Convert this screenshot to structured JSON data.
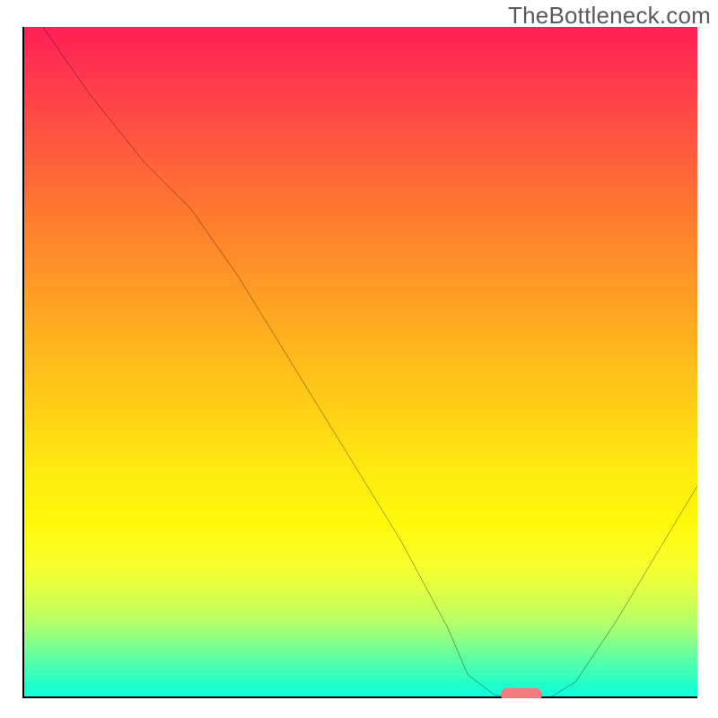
{
  "watermark": "TheBottleneck.com",
  "chart_data": {
    "type": "line",
    "title": "",
    "xlabel": "",
    "ylabel": "",
    "xlim": [
      0,
      100
    ],
    "ylim": [
      0,
      100
    ],
    "grid": false,
    "legend": false,
    "background_gradient": {
      "top": "#ff1f57",
      "bottom": "#0affe0",
      "direction": "vertical",
      "meaning": "bottleneck-severity-heatmap"
    },
    "series": [
      {
        "name": "bottleneck-curve",
        "color": "#000000",
        "x": [
          3,
          10,
          18,
          25,
          32,
          40,
          48,
          56,
          63,
          66,
          70,
          75,
          78,
          82,
          88,
          94,
          100
        ],
        "y": [
          100,
          90,
          80,
          73,
          63,
          50,
          37,
          24,
          11,
          4,
          1,
          0.5,
          0.5,
          3,
          12,
          22,
          32
        ]
      }
    ],
    "marker": {
      "name": "recommended-range",
      "center_x": 74,
      "y": 0.5,
      "color": "#f37b7d",
      "shape": "pill"
    }
  }
}
